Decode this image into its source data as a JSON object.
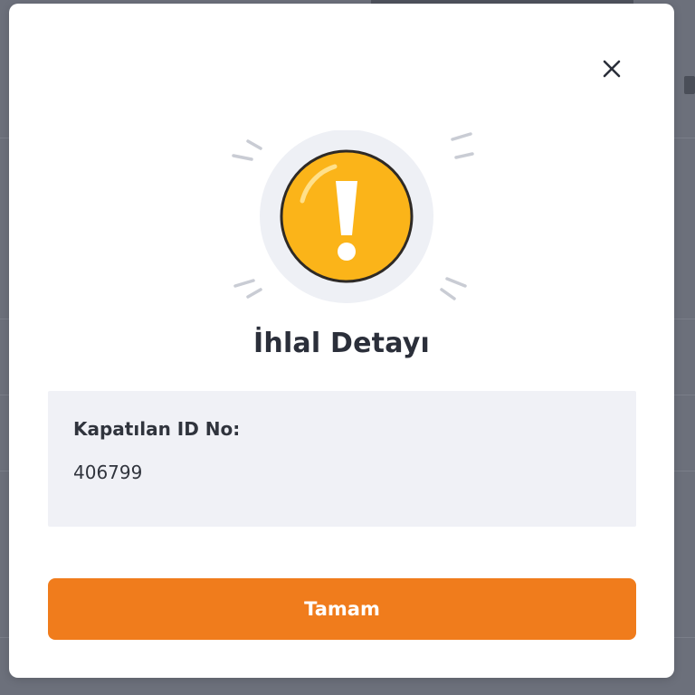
{
  "dialog": {
    "title": "İhlal Detayı",
    "close_icon": "close-icon",
    "alert_icon": "exclamation-warning-icon",
    "info": {
      "label": "Kapatılan ID No:",
      "value": "406799"
    },
    "ok_label": "Tamam"
  },
  "colors": {
    "accent_orange": "#f07c1c",
    "warning_yellow": "#fbb419",
    "panel_bg": "#f0f1f6",
    "text_dark": "#2b2f3a",
    "backdrop": "#6c707b"
  }
}
